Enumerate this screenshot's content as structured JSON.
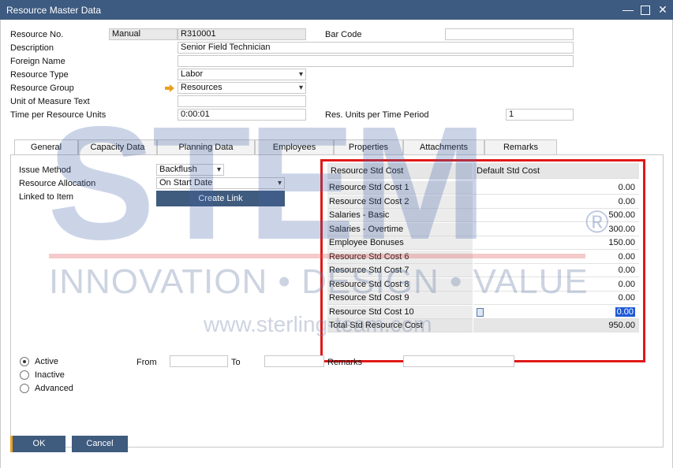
{
  "window": {
    "title": "Resource Master Data",
    "minimize": "—",
    "close": "✕"
  },
  "header": {
    "resource_no_label": "Resource No.",
    "series": "Manual",
    "resource_no": "R310001",
    "description_label": "Description",
    "description": "Senior Field Technician",
    "foreign_name_label": "Foreign Name",
    "foreign_name": "",
    "resource_type_label": "Resource Type",
    "resource_type": "Labor",
    "resource_group_label": "Resource Group",
    "resource_group": "Resources",
    "uom_text_label": "Unit of Measure Text",
    "uom_text": "",
    "time_per_units_label": "Time per Resource Units",
    "time_per_units": "0:00:01",
    "bar_code_label": "Bar Code",
    "bar_code": "",
    "res_units_label": "Res. Units per Time Period",
    "res_units": "1"
  },
  "tabs": [
    "General",
    "Capacity Data",
    "Planning Data",
    "Employees",
    "Properties",
    "Attachments",
    "Remarks"
  ],
  "general": {
    "issue_method_label": "Issue Method",
    "issue_method": "Backflush",
    "allocation_label": "Resource Allocation",
    "allocation": "On Start Date",
    "linked_label": "Linked to Item",
    "create_link": "Create Link"
  },
  "cost_grid": {
    "col1_header": "Resource Std Cost",
    "col2_header": "Default Std Cost",
    "rows": [
      {
        "label": "Resource Std Cost 1",
        "value": "0.00"
      },
      {
        "label": "Resource Std Cost 2",
        "value": "0.00"
      },
      {
        "label": "Salaries - Basic",
        "value": "500.00"
      },
      {
        "label": "Salaries - Overtime",
        "value": "300.00"
      },
      {
        "label": "Employee Bonuses",
        "value": "150.00"
      },
      {
        "label": "Resource Std Cost 6",
        "value": "0.00"
      },
      {
        "label": "Resource Std Cost 7",
        "value": "0.00"
      },
      {
        "label": "Resource Std Cost 8",
        "value": "0.00"
      },
      {
        "label": "Resource Std Cost 9",
        "value": "0.00"
      },
      {
        "label": "Resource Std Cost 10",
        "value": "0.00"
      }
    ],
    "total_label": "Total Std Resource Cost",
    "total_value": "950.00"
  },
  "status": {
    "active": "Active",
    "inactive": "Inactive",
    "advanced": "Advanced",
    "from_label": "From",
    "to_label": "To",
    "remarks_label": "Remarks"
  },
  "buttons": {
    "ok": "OK",
    "cancel": "Cancel"
  },
  "watermark": {
    "brand": "STEM",
    "registered": "®",
    "tagline": "INNOVATION • DESIGN • VALUE",
    "url": "www.sterling-team.com"
  },
  "colors": {
    "titlebar": "#3d5a80",
    "button": "#3f5b7e",
    "highlight_frame": "#e01818",
    "selection": "#1f5ad6"
  }
}
